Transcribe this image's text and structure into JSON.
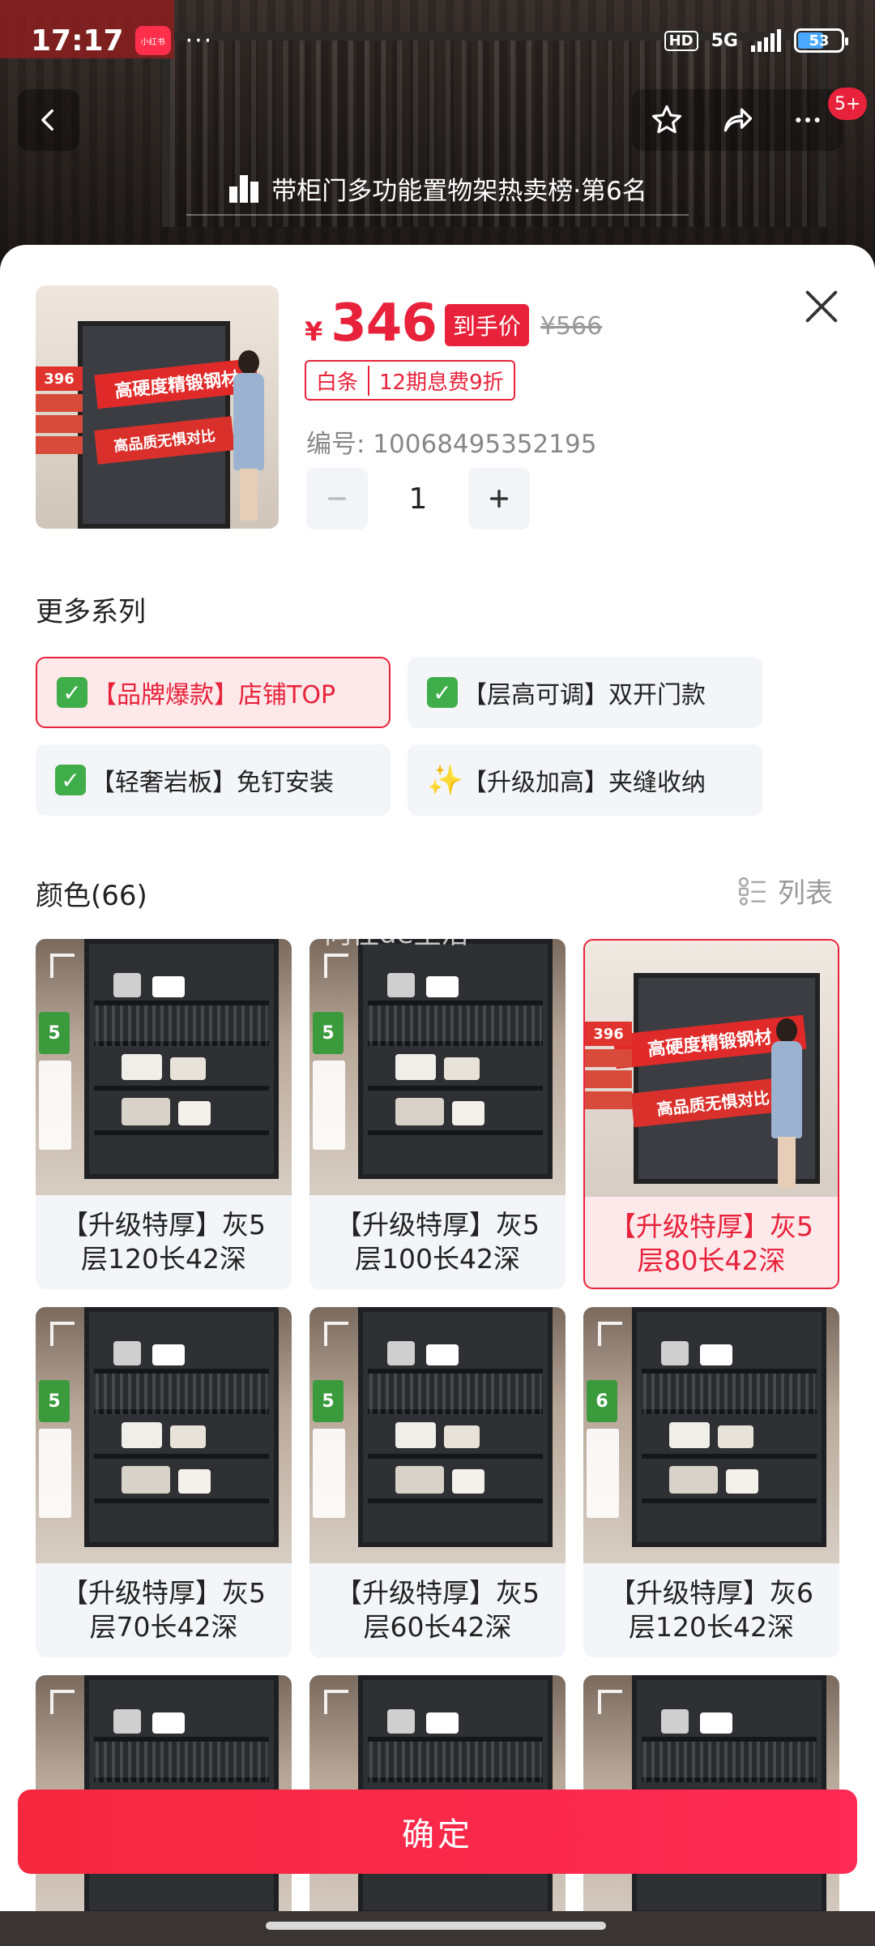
{
  "status_bar": {
    "time": "17:17",
    "app_badge": "小红书",
    "dots": "···",
    "hd": "HD",
    "network": "5G",
    "battery": "53"
  },
  "nav": {
    "message_badge": "5+",
    "rank_banner": "带柜门多功能置物架热卖榜·第6名"
  },
  "product": {
    "currency": "¥",
    "price": "346",
    "price_tag": "到手价",
    "original_price": "¥566",
    "baitiao_label": "白条",
    "baitiao_offer": "12期息费9折",
    "sku": "编号: 10068495352195",
    "quantity": "1",
    "thumb_banner_1": "高硬度精锻钢材",
    "thumb_banner_2": "高品质无惧对比",
    "thumb_price": "396"
  },
  "series_section": {
    "title": "更多系列",
    "items": [
      {
        "icon": "✓",
        "label": "【品牌爆款】店铺TOP"
      },
      {
        "icon": "✓",
        "label": "【层高可调】双开门款"
      },
      {
        "icon": "✓",
        "label": "【轻奢岩板】免钉安装"
      },
      {
        "icon": "✨",
        "label": "【升级加高】夹缝收纳"
      }
    ]
  },
  "color_section": {
    "title": "颜色(66)",
    "list_toggle": "列表",
    "watermark": "向往de生活"
  },
  "variants": [
    {
      "label": "【升级特厚】灰5层120长42深",
      "tag": "5"
    },
    {
      "label": "【升级特厚】灰5层100长42深",
      "tag": "5"
    },
    {
      "label": "【升级特厚】灰5层80长42深",
      "tag": ""
    },
    {
      "label": "【升级特厚】灰5层70长42深",
      "tag": "5"
    },
    {
      "label": "【升级特厚】灰5层60长42深",
      "tag": "5"
    },
    {
      "label": "【升级特厚】灰6层120长42深",
      "tag": "6"
    }
  ],
  "selected_variant": 2,
  "confirm_label": "确定",
  "colors": {
    "accent": "#e8223a",
    "check_green": "#3fae4a",
    "chip_bg": "#f4f5f8"
  }
}
